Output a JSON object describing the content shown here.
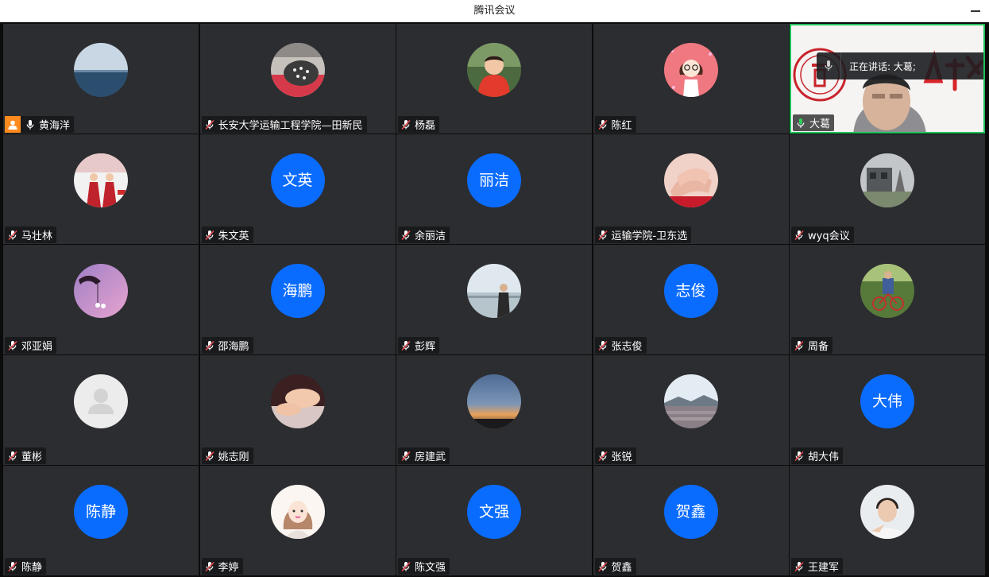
{
  "window": {
    "title": "腾讯会议"
  },
  "speaking_indicator": {
    "label": "正在讲话: 大葛;"
  },
  "colors": {
    "tile_bg": "#2c2d30",
    "text_avatar": "#0a6cff",
    "speaker_border": "#20c05c",
    "host_badge": "#ff8a1d",
    "mic_muted": "#e5484d"
  },
  "participants": [
    {
      "name": "黄海洋",
      "mic": "on",
      "host": true,
      "avatar": {
        "kind": "photo",
        "icon": "sea-horizon-photo"
      }
    },
    {
      "name": "长安大学运输工程学院—田新民",
      "mic": "muted",
      "avatar": {
        "kind": "photo",
        "icon": "shoes-photo"
      }
    },
    {
      "name": "杨磊",
      "mic": "muted",
      "avatar": {
        "kind": "photo",
        "icon": "child-photo"
      }
    },
    {
      "name": "陈红",
      "mic": "muted",
      "avatar": {
        "kind": "photo",
        "icon": "cartoon-girl-avatar"
      }
    },
    {
      "name": "大葛",
      "mic": "speaking",
      "video": true,
      "avatar": {
        "kind": "video",
        "icon": "camera-feed"
      }
    },
    {
      "name": "马壮林",
      "mic": "muted",
      "avatar": {
        "kind": "photo",
        "icon": "performers-photo"
      }
    },
    {
      "name": "朱文英",
      "mic": "muted",
      "avatar": {
        "kind": "text",
        "text": "文英"
      }
    },
    {
      "name": "余丽洁",
      "mic": "muted",
      "avatar": {
        "kind": "text",
        "text": "丽洁"
      }
    },
    {
      "name": "运输学院-卫东选",
      "mic": "muted",
      "avatar": {
        "kind": "photo",
        "icon": "hands-photo"
      }
    },
    {
      "name": "wyq会议",
      "mic": "muted",
      "avatar": {
        "kind": "photo",
        "icon": "building-photo"
      }
    },
    {
      "name": "邓亚娟",
      "mic": "muted",
      "avatar": {
        "kind": "photo",
        "icon": "purple-sky-photo"
      }
    },
    {
      "name": "邵海鹏",
      "mic": "muted",
      "avatar": {
        "kind": "text",
        "text": "海鹏"
      }
    },
    {
      "name": "彭辉",
      "mic": "muted",
      "avatar": {
        "kind": "photo",
        "icon": "man-by-water-photo"
      }
    },
    {
      "name": "张志俊",
      "mic": "muted",
      "avatar": {
        "kind": "text",
        "text": "志俊"
      }
    },
    {
      "name": "周备",
      "mic": "muted",
      "avatar": {
        "kind": "photo",
        "icon": "cyclist-photo"
      }
    },
    {
      "name": "董彬",
      "mic": "muted",
      "avatar": {
        "kind": "default",
        "icon": "default-person-avatar"
      }
    },
    {
      "name": "姚志刚",
      "mic": "muted",
      "avatar": {
        "kind": "photo",
        "icon": "baby-feet-photo"
      }
    },
    {
      "name": "房建武",
      "mic": "muted",
      "avatar": {
        "kind": "photo",
        "icon": "sunset-photo"
      }
    },
    {
      "name": "张锐",
      "mic": "muted",
      "avatar": {
        "kind": "photo",
        "icon": "landscape-photo"
      }
    },
    {
      "name": "胡大伟",
      "mic": "muted",
      "avatar": {
        "kind": "text",
        "text": "大伟"
      }
    },
    {
      "name": "陈静",
      "mic": "muted",
      "avatar": {
        "kind": "text",
        "text": "陈静"
      }
    },
    {
      "name": "李婷",
      "mic": "muted",
      "avatar": {
        "kind": "photo",
        "icon": "cartoon-woman-avatar"
      }
    },
    {
      "name": "陈文强",
      "mic": "muted",
      "avatar": {
        "kind": "text",
        "text": "文强"
      }
    },
    {
      "name": "贺鑫",
      "mic": "muted",
      "avatar": {
        "kind": "text",
        "text": "贺鑫"
      }
    },
    {
      "name": "王建军",
      "mic": "muted",
      "avatar": {
        "kind": "photo",
        "icon": "young-man-photo"
      }
    }
  ]
}
